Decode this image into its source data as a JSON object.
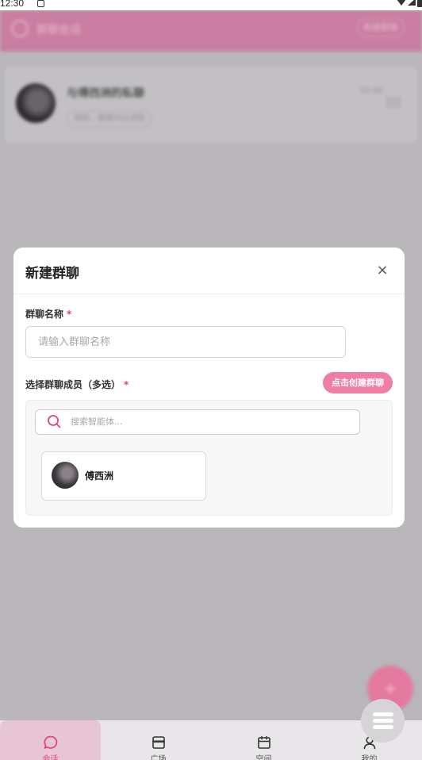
{
  "status_bar": {
    "time": "12:30"
  },
  "background": {
    "header_title": "群聊会话",
    "header_button": "新建群聊",
    "card_name": "与傅西洲的私聊",
    "card_time": "12:30",
    "card_message": "你好，很高兴认识你",
    "fab_label": "+"
  },
  "modal": {
    "title": "新建群聊",
    "close_icon": "×",
    "name_label": "群聊名称",
    "required_mark": "*",
    "name_placeholder": "请输入群聊名称",
    "members_label": "选择群聊成员（多选）",
    "create_button": "点击创建群聊",
    "search_placeholder": "搜索智能体...",
    "members": [
      {
        "name": "傅西洲"
      }
    ]
  },
  "bottom_nav": {
    "items": [
      {
        "label": "会话",
        "icon": "chat-bubble-icon",
        "active": true
      },
      {
        "label": "广场",
        "icon": "store-icon",
        "active": false
      },
      {
        "label": "空间",
        "icon": "calendar-icon",
        "active": false
      },
      {
        "label": "我的",
        "icon": "user-icon",
        "active": false
      }
    ]
  },
  "colors": {
    "accent": "#e0437a",
    "button_pink": "#f07ea3",
    "overlay": "#b9b7ba"
  }
}
